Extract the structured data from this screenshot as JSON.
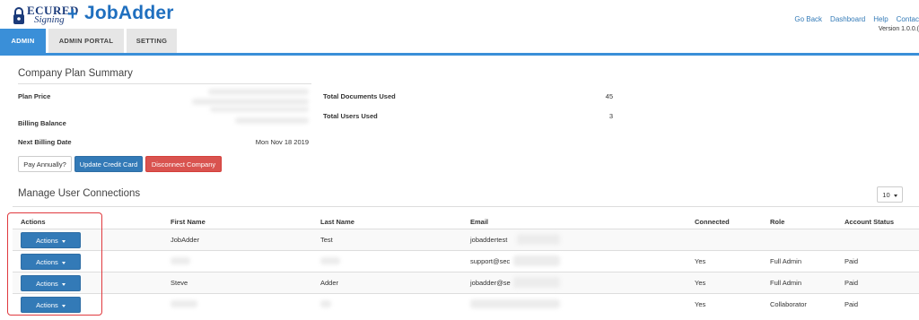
{
  "header": {
    "logo_line1": "ECURED",
    "logo_line2": "Signing",
    "plus": "+",
    "jobadder": "JobAdder",
    "links": [
      "Go Back",
      "Dashboard",
      "Help",
      "Contac"
    ],
    "version": "Version 1.0.0.("
  },
  "tabs": [
    {
      "label": "ADMIN",
      "active": true
    },
    {
      "label": "ADMIN PORTAL",
      "active": false
    },
    {
      "label": "SETTING",
      "active": false
    }
  ],
  "plan": {
    "title": "Company Plan Summary",
    "plan_price_label": "Plan Price",
    "billing_balance_label": "Billing Balance",
    "next_billing_label": "Next Billing Date",
    "next_billing_value": "Mon Nov 18 2019",
    "total_docs_label": "Total Documents Used",
    "total_docs_value": "45",
    "total_users_label": "Total Users Used",
    "total_users_value": "3",
    "buttons": {
      "pay_annually": "Pay Annually?",
      "update_card": "Update Credit Card",
      "disconnect": "Disconnect Company"
    }
  },
  "users": {
    "title": "Manage User Connections",
    "page_size": "10",
    "columns": [
      "Actions",
      "First Name",
      "Last Name",
      "Email",
      "Connected",
      "Role",
      "Account Status"
    ],
    "action_label": "Actions",
    "rows": [
      {
        "first": "JobAdder",
        "last": "Test",
        "email": "jobaddertest",
        "connected": "",
        "role": "",
        "status": ""
      },
      {
        "first": "",
        "last": "",
        "email": "support@sec",
        "connected": "Yes",
        "role": "Full Admin",
        "status": "Paid"
      },
      {
        "first": "Steve",
        "last": "Adder",
        "email": "jobadder@se",
        "connected": "Yes",
        "role": "Full Admin",
        "status": "Paid"
      },
      {
        "first": "",
        "last": "",
        "email": "",
        "connected": "Yes",
        "role": "Collaborator",
        "status": "Paid"
      }
    ]
  },
  "colors": {
    "primary": "#337ab7",
    "tab_active": "#3a8fd8",
    "danger": "#d9534f",
    "brand": "#1f6fbf",
    "highlight": "#e0393e"
  }
}
